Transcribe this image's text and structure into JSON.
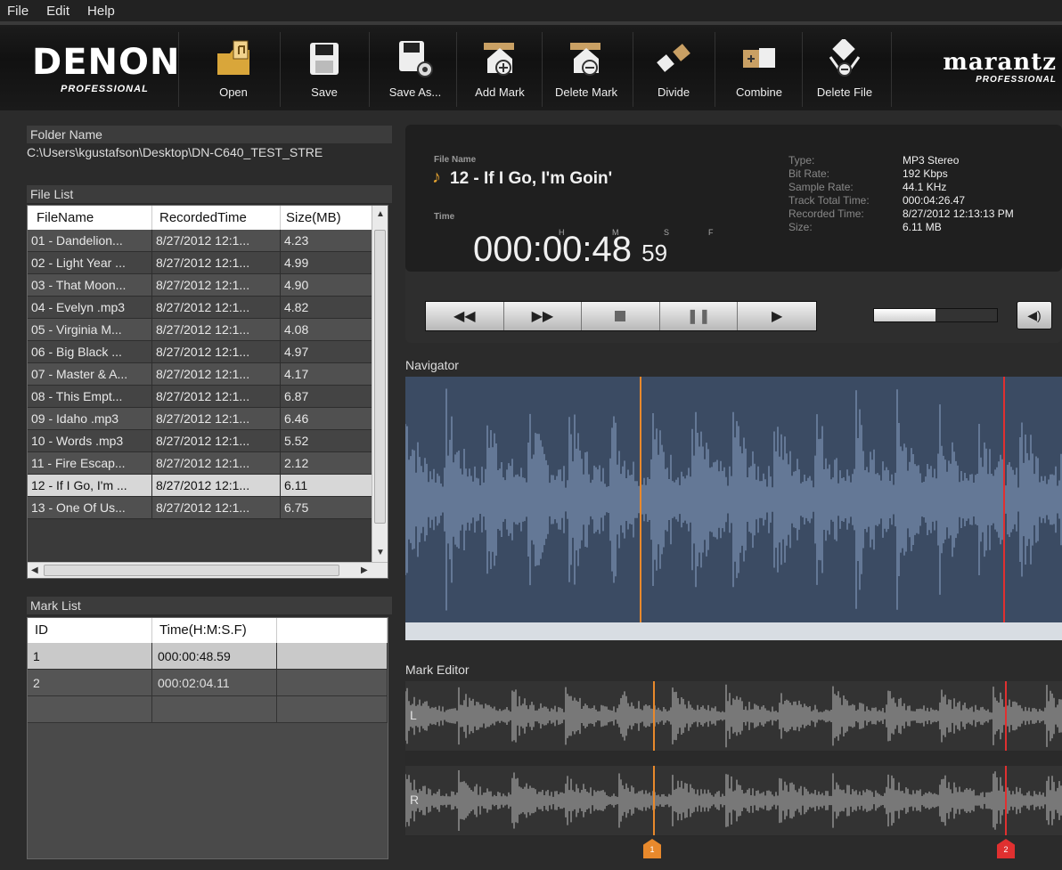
{
  "menu": [
    "File",
    "Edit",
    "Help"
  ],
  "brand_left": {
    "name": "DENON",
    "sub": "PROFESSIONAL"
  },
  "brand_right": {
    "name": "marantz",
    "sub": "PROFESSIONAL"
  },
  "toolbar": [
    {
      "label": "Open",
      "icon": "folder-open-icon"
    },
    {
      "label": "Save",
      "icon": "floppy-disk-icon"
    },
    {
      "label": "Save As...",
      "icon": "save-as-icon"
    },
    {
      "label": "Add Mark",
      "icon": "add-mark-icon"
    },
    {
      "label": "Delete Mark",
      "icon": "delete-mark-icon"
    },
    {
      "label": "Divide",
      "icon": "divide-icon"
    },
    {
      "label": "Combine",
      "icon": "combine-icon"
    },
    {
      "label": "Delete File",
      "icon": "delete-file-icon"
    }
  ],
  "folder": {
    "label": "Folder Name",
    "path": "C:\\Users\\kgustafson\\Desktop\\DN-C640_TEST_STRE"
  },
  "file_list": {
    "label": "File List",
    "columns": [
      "FileName",
      "RecordedTime",
      "Size(MB)"
    ],
    "rows": [
      [
        "01 - Dandelion...",
        "8/27/2012 12:1...",
        "4.23"
      ],
      [
        "02 - Light Year ...",
        "8/27/2012 12:1...",
        "4.99"
      ],
      [
        "03 - That Moon...",
        "8/27/2012 12:1...",
        "4.90"
      ],
      [
        "04 - Evelyn .mp3",
        "8/27/2012 12:1...",
        "4.82"
      ],
      [
        "05 - Virginia M...",
        "8/27/2012 12:1...",
        "4.08"
      ],
      [
        "06 - Big Black ...",
        "8/27/2012 12:1...",
        "4.97"
      ],
      [
        "07 - Master & A...",
        "8/27/2012 12:1...",
        "4.17"
      ],
      [
        "08 - This Empt...",
        "8/27/2012 12:1...",
        "6.87"
      ],
      [
        "09 - Idaho .mp3",
        "8/27/2012 12:1...",
        "6.46"
      ],
      [
        "10 - Words .mp3",
        "8/27/2012 12:1...",
        "5.52"
      ],
      [
        "11 - Fire Escap...",
        "8/27/2012 12:1...",
        "2.12"
      ],
      [
        "12 - If I Go, I'm ...",
        "8/27/2012 12:1...",
        "6.11"
      ],
      [
        "13 - One Of Us...",
        "8/27/2012 12:1...",
        "6.75"
      ]
    ],
    "selected_index": 11
  },
  "mark_list": {
    "label": "Mark List",
    "columns": [
      "ID",
      "Time(H:M:S.F)",
      ""
    ],
    "rows": [
      [
        "1",
        "000:00:48.59",
        ""
      ],
      [
        "2",
        "000:02:04.11",
        ""
      ],
      [
        "",
        "",
        ""
      ]
    ]
  },
  "player": {
    "file_name_label": "File Name",
    "file_name": "12 - If I Go, I'm Goin'",
    "time_label": "Time",
    "time_h": "000",
    "time_m": "00",
    "time_s": "48",
    "time_f": "59",
    "units": {
      "h": "H",
      "m": "M",
      "s": "S",
      "f": "F"
    },
    "meta": [
      {
        "key": "Type:",
        "value": "MP3  Stereo"
      },
      {
        "key": "Bit Rate:",
        "value": "192 Kbps"
      },
      {
        "key": "Sample Rate:",
        "value": "44.1 KHz"
      },
      {
        "key": "Track Total Time:",
        "value": "000:04:26.47"
      },
      {
        "key": "Recorded Time:",
        "value": "8/27/2012 12:13:13 PM"
      },
      {
        "key": "Size:",
        "value": "6.11 MB"
      }
    ],
    "transport": [
      "rewind-icon",
      "fast-forward-icon",
      "stop-icon",
      "pause-icon",
      "play-icon"
    ],
    "volume_fraction": 0.5
  },
  "navigator_label": "Navigator",
  "editor": {
    "label": "Mark Editor",
    "channels": [
      "L",
      "R"
    ],
    "markers": [
      "1",
      "2"
    ]
  },
  "colors": {
    "mark1": "#e8892c",
    "mark2": "#e03030",
    "navigator_bg": "#3b4b63",
    "wave_nav": "#6f84a3",
    "wave_edit": "#8a8a8a"
  }
}
